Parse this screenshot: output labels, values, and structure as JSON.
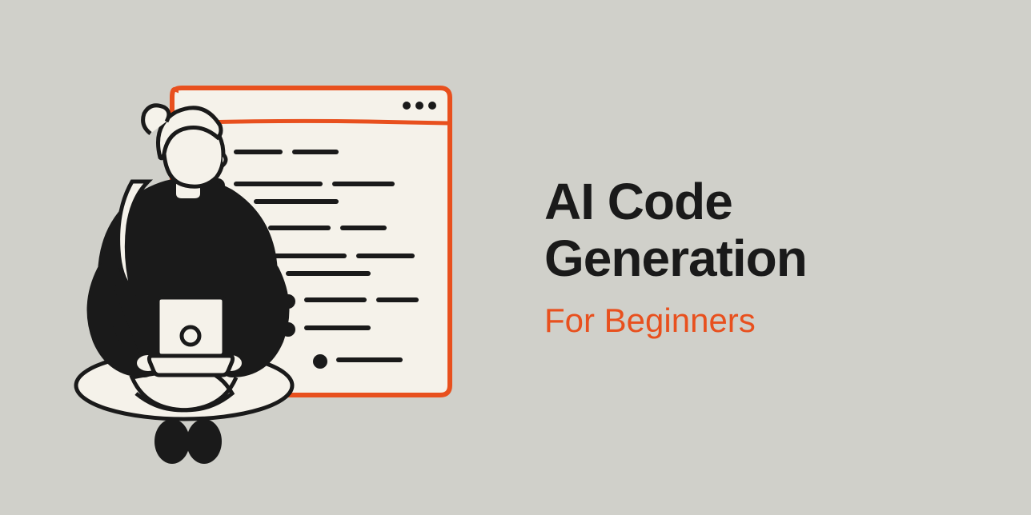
{
  "hero": {
    "title": "AI Code Generation",
    "subtitle": "For Beginners"
  },
  "colors": {
    "background": "#d0d0ca",
    "accent": "#e8501e",
    "text": "#1a1a1a",
    "illustration_fill": "#f5f2ea"
  }
}
